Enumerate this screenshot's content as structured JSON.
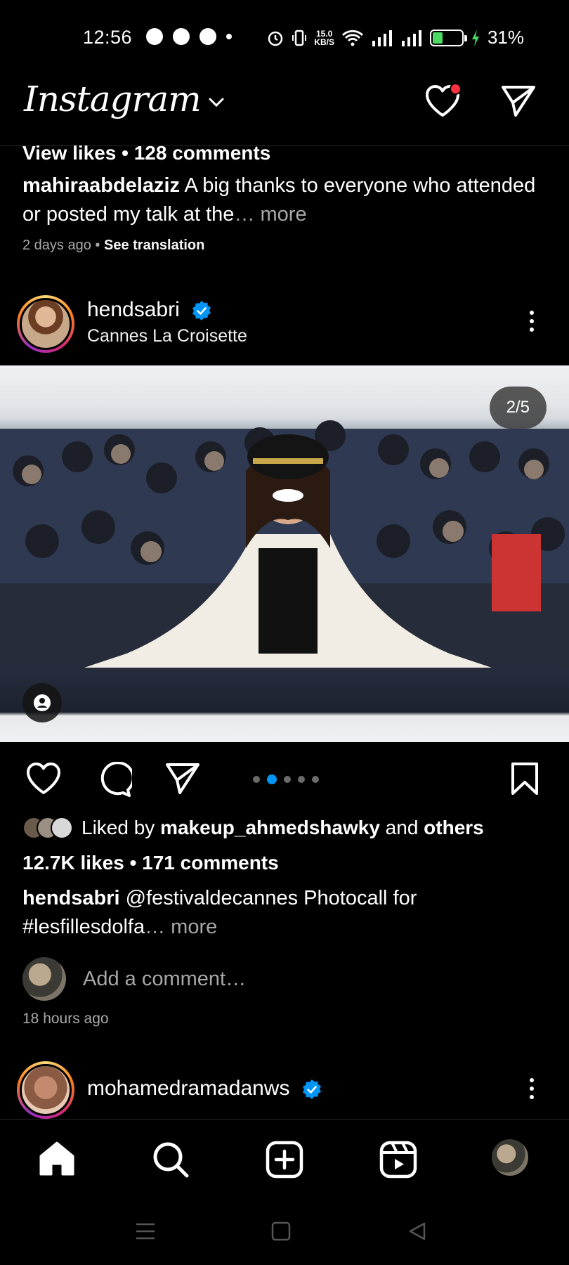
{
  "status_bar": {
    "time": "12:56",
    "net_speed_value": "15.0",
    "net_speed_unit": "KB/S",
    "battery_percent": "31%",
    "battery_level": 0.31,
    "icons": [
      "chat-bubble-icon",
      "snapchat-icon",
      "messenger-icon",
      "dot-icon",
      "alarm-icon",
      "vibrate-icon",
      "wifi-icon",
      "signal-icon",
      "signal-icon",
      "battery-icon",
      "charging-icon"
    ]
  },
  "header": {
    "logo": "Instagram",
    "has_notifications": true
  },
  "previous_post": {
    "view_likes": "View likes",
    "comments": "128 comments",
    "caption_user": "mahiraabdelaziz",
    "caption_text": "A big thanks to everyone who attended or posted my talk at the",
    "more": "… more",
    "time": "2 days ago",
    "translation": "See translation"
  },
  "post": {
    "username": "hendsabri",
    "location": "Cannes La Croisette",
    "counter": "2/5",
    "carousel_count": 5,
    "carousel_active": 2,
    "liked_by_prefix": "Liked by",
    "liked_by_user": "makeup_ahmedshawky",
    "liked_by_and": "and",
    "liked_by_others": "others",
    "likes": "12.7K likes",
    "comments": "171 comments",
    "caption_user": "hendsabri",
    "caption_text": "@festivaldecannes Photocall for #lesfillesdolfa",
    "more": "… more",
    "add_comment_placeholder": "Add a comment…",
    "time": "18 hours ago"
  },
  "next_post": {
    "username": "mohamedramadanws"
  },
  "bottom_nav": [
    "home-icon",
    "search-icon",
    "create-icon",
    "reels-icon",
    "profile-avatar"
  ],
  "colors": {
    "background": "#000000",
    "accent_blue": "#0095f6",
    "notification_red": "#ff3040",
    "muted_text": "#a8a8a8"
  }
}
